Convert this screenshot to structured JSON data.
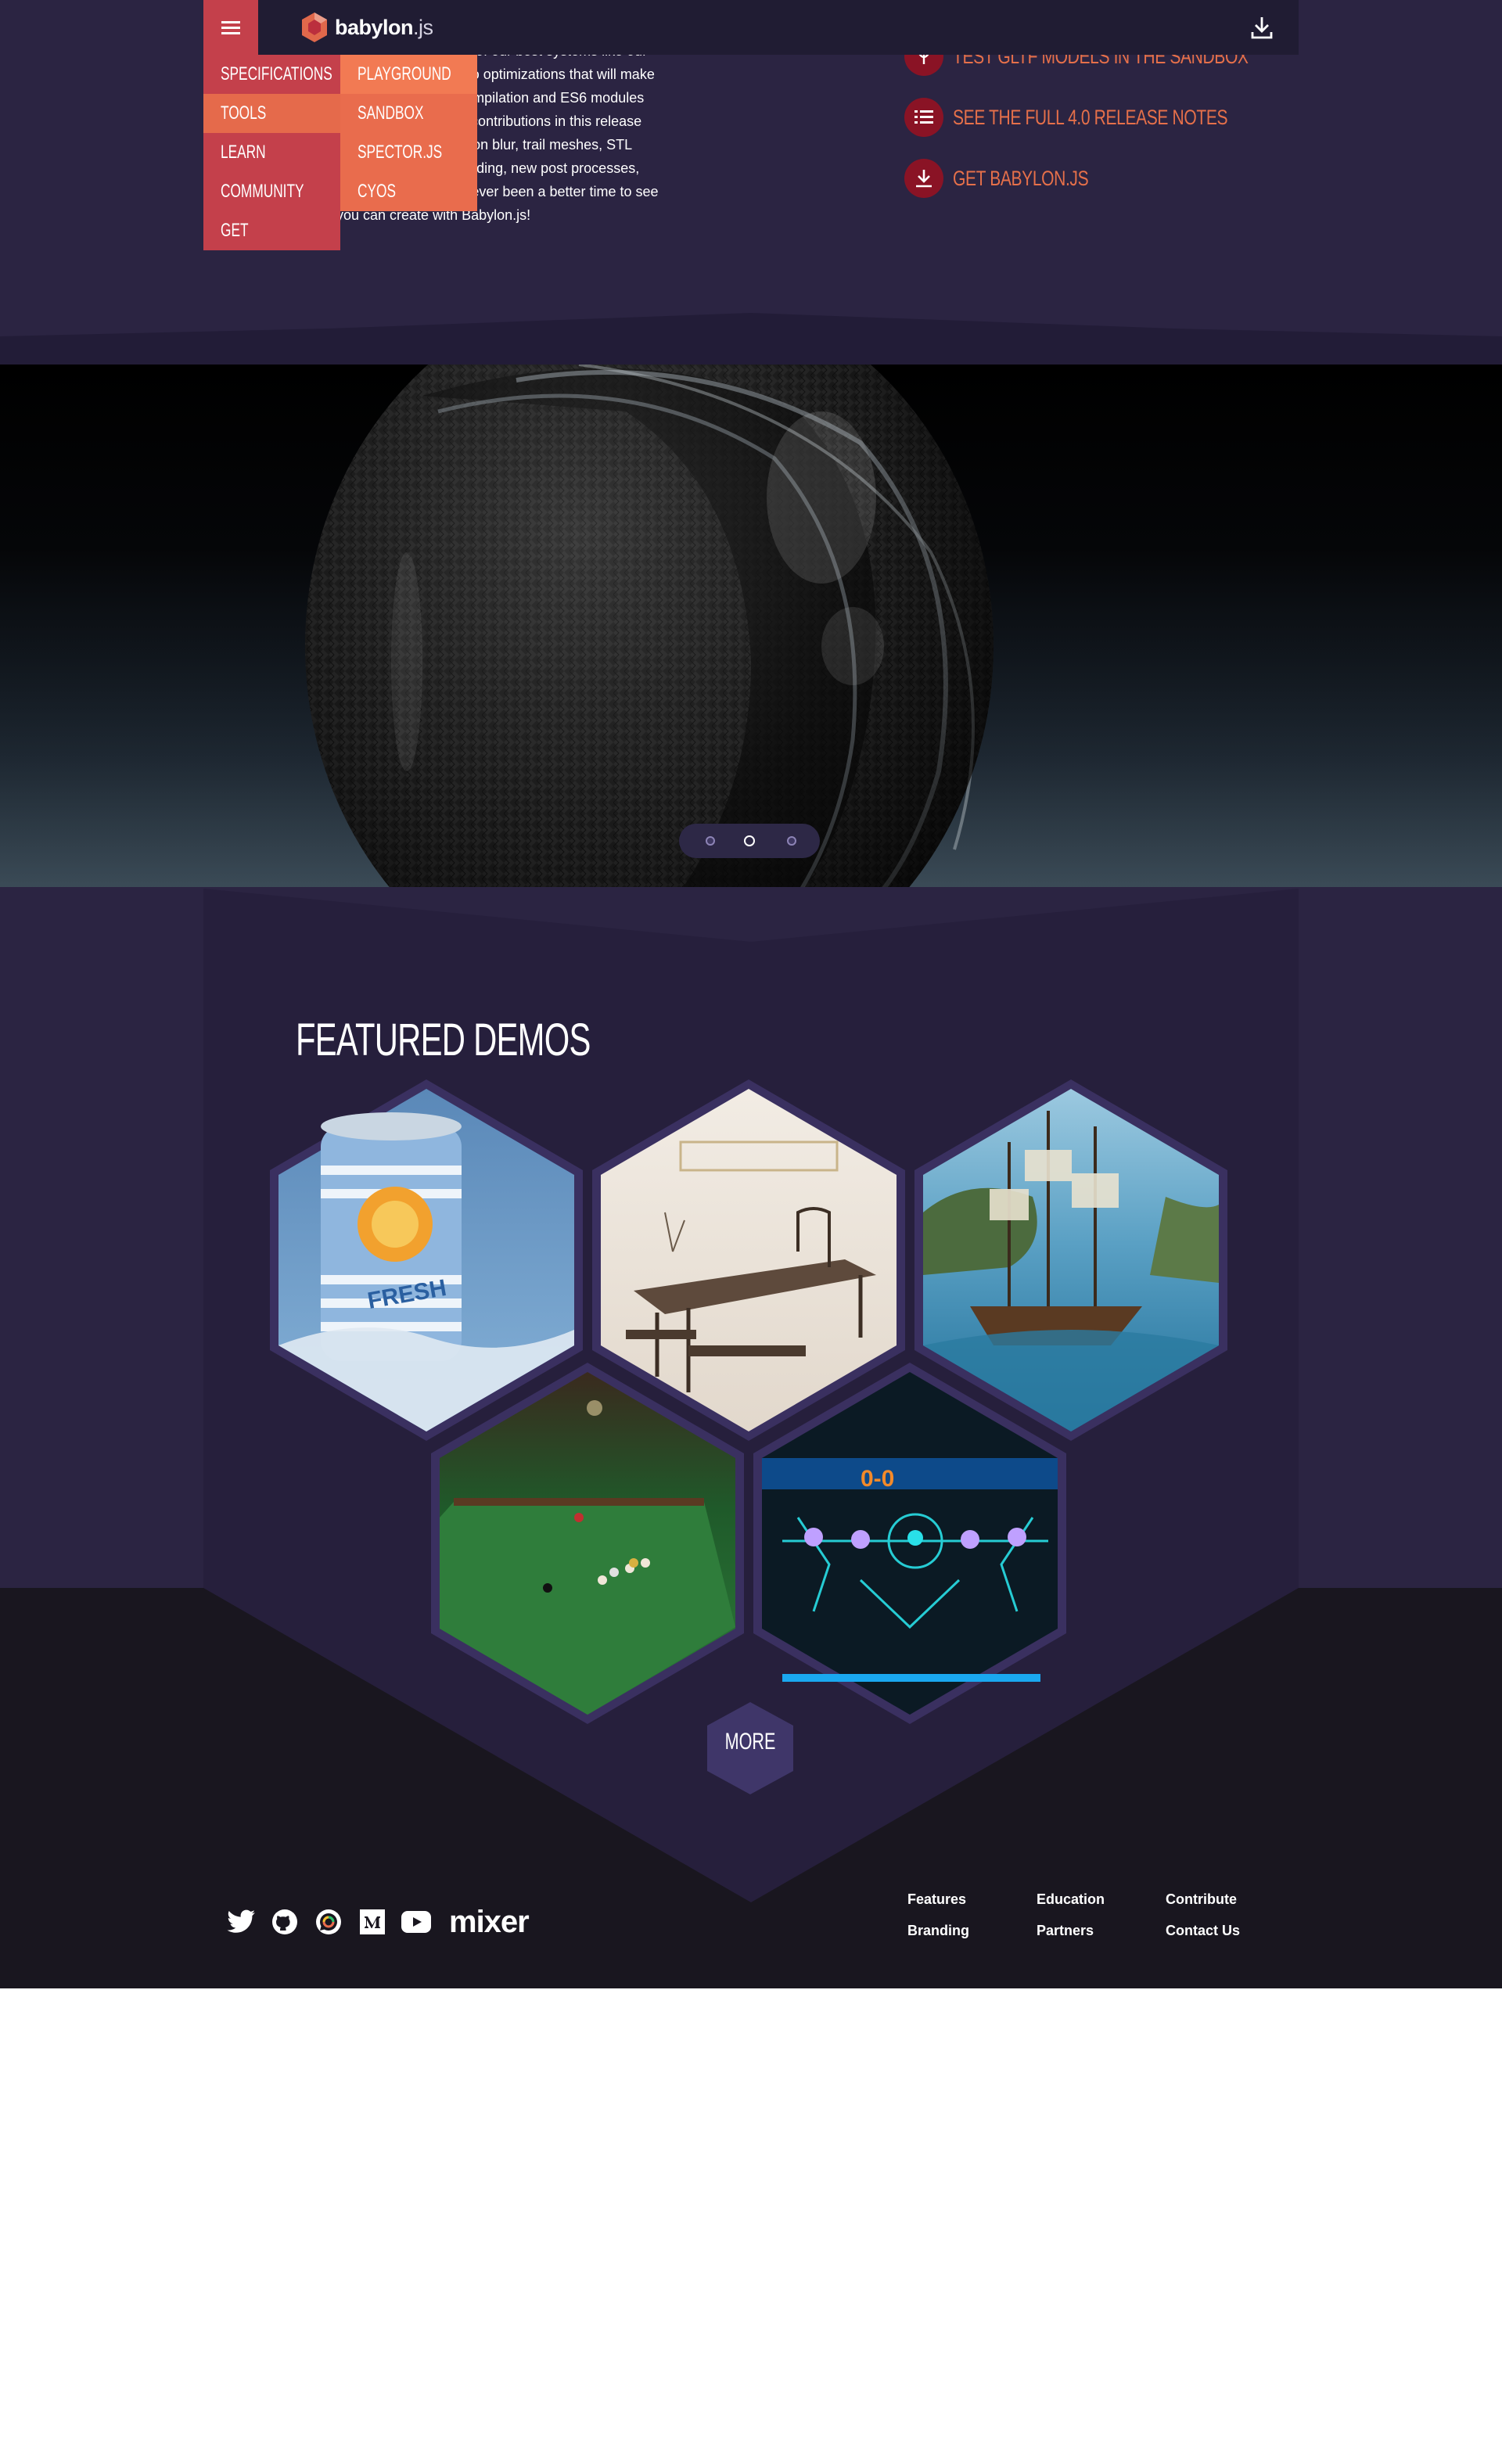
{
  "intro": {
    "lines": [
      "ures updates to some of our best systems like our",
      "ystems. There are also optimizations that will make",
      "like parallel shader compilation and ES6 modules",
      "are many community contributions in this release",
      "like object-based motion blur, trail meshes, STL",
      "text selection, OBJ loading, new post processes,",
      "al library. There has never been a better time to see",
      "you can create with Babylon.js!"
    ]
  },
  "actions": [
    {
      "label": "TEST GLTF MODELS IN THE SANDBOX",
      "icon": "gltf-icon"
    },
    {
      "label": "SEE THE FULL 4.0 RELEASE NOTES",
      "icon": "list-icon"
    },
    {
      "label": "GET BABYLON.JS",
      "icon": "download-icon"
    }
  ],
  "header": {
    "logo_brand": "babylon",
    "logo_suffix": ".js"
  },
  "nav": {
    "main": [
      "SPECIFICATIONS",
      "TOOLS",
      "LEARN",
      "COMMUNITY",
      "GET"
    ],
    "active_main": "TOOLS",
    "tools_submenu": [
      "PLAYGROUND",
      "SANDBOX",
      "SPECTOR.JS",
      "CYOS"
    ],
    "active_sub": "PLAYGROUND"
  },
  "hero": {
    "slides": 3,
    "active_slide": 2
  },
  "demos": {
    "title": "FEATURED DEMOS",
    "items": [
      {
        "id": "fresh-juice",
        "icon": "soda-can-image"
      },
      {
        "id": "tea-room",
        "icon": "table-image"
      },
      {
        "id": "pirate-ship",
        "icon": "ship-image"
      },
      {
        "id": "billiards",
        "icon": "pool-table-image"
      },
      {
        "id": "air-hockey",
        "icon": "air-hockey-image"
      }
    ],
    "more_label": "MORE"
  },
  "footer": {
    "social": [
      "twitter-icon",
      "github-icon",
      "forum-icon",
      "medium-icon",
      "youtube-icon"
    ],
    "mixer_label": "mixer",
    "links": [
      "Features",
      "Education",
      "Contribute",
      "Branding",
      "Partners",
      "Contact Us"
    ]
  },
  "colors": {
    "band": "#2b2442",
    "header": "#201c33",
    "nav_main": "#c4404b",
    "nav_sub": "#e96c4d",
    "accent_text": "#e6704a",
    "cta_circle": "#8a1325",
    "footer": "#19161f"
  }
}
